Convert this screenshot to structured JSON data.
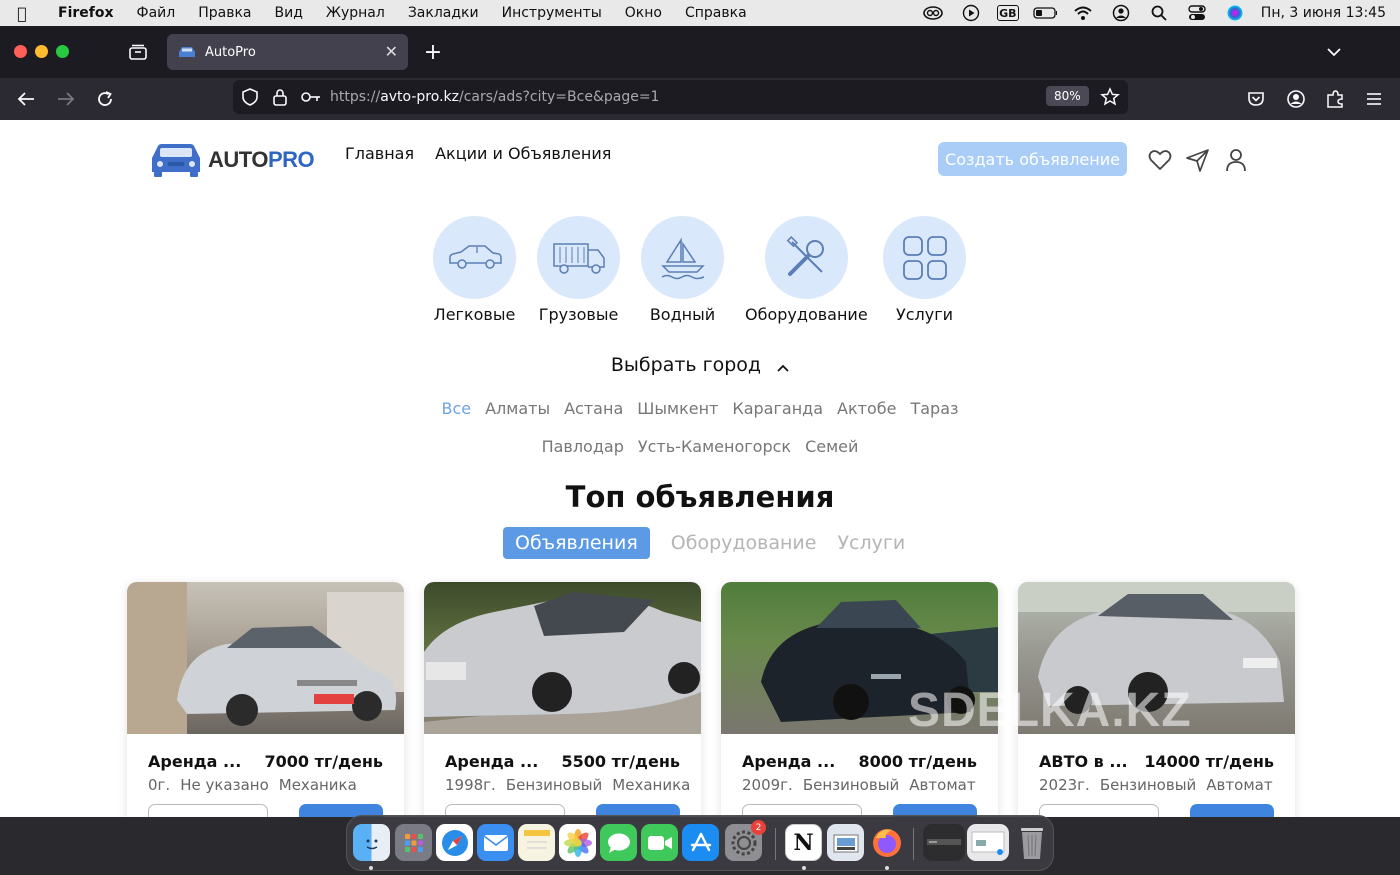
{
  "menubar": {
    "app_name": "Firefox",
    "items": [
      "Файл",
      "Правка",
      "Вид",
      "Журнал",
      "Закладки",
      "Инструменты",
      "Окно",
      "Справка"
    ],
    "clock": "Пн, 3 июня  13:45",
    "keyboard_layout": "GB"
  },
  "browser": {
    "tab_title": "AutoPro",
    "url_prefix": "https://",
    "url_domain": "avto-pro.kz",
    "url_path": "/cars/ads?city=Все&page=1",
    "zoom": "80%"
  },
  "site": {
    "logo_auto": "AUTO",
    "logo_pro": "PRO",
    "nav": [
      "Главная",
      "Акции и Объявления"
    ],
    "create_button": "Создать объявление",
    "categories": [
      {
        "label": "Легковые",
        "icon": "car-icon"
      },
      {
        "label": "Грузовые",
        "icon": "truck-icon"
      },
      {
        "label": "Водный",
        "icon": "boat-icon"
      },
      {
        "label": "Оборудование",
        "icon": "tools-icon"
      },
      {
        "label": "Услуги",
        "icon": "grid-icon"
      }
    ],
    "city_title": "Выбрать город",
    "cities_row1": [
      "Все",
      "Алматы",
      "Астана",
      "Шымкент",
      "Караганда",
      "Актобе",
      "Тараз"
    ],
    "cities_row2": [
      "Павлодар",
      "Усть-Каменогорск",
      "Семей"
    ],
    "active_city": "Все",
    "top_title": "Топ объявления",
    "tabs": [
      "Объявления",
      "Оборудование",
      "Услуги"
    ],
    "active_tab": "Объявления",
    "cards": [
      {
        "title": "Аренда ...",
        "price": "7000 тг/день",
        "year": "0г.",
        "fuel": "Не указано",
        "transmission": "Механика"
      },
      {
        "title": "Аренда ...",
        "price": "5500 тг/день",
        "year": "1998г.",
        "fuel": "Бензиновый",
        "transmission": "Механика"
      },
      {
        "title": "Аренда ...",
        "price": "8000 тг/день",
        "year": "2009г.",
        "fuel": "Бензиновый",
        "transmission": "Автомат"
      },
      {
        "title": "АВТО в ...",
        "price": "14000 тг/день",
        "year": "2023г.",
        "fuel": "Бензиновый",
        "transmission": "Автомат"
      }
    ],
    "watermark": "SDELKA.KZ"
  },
  "dock": {
    "apps": [
      "Finder",
      "Launchpad",
      "Safari",
      "Mail",
      "Notes",
      "Photos",
      "Messages",
      "FaceTime",
      "App Store",
      "System Settings",
      "Notion",
      "Preview",
      "Firefox",
      "Screenshot",
      "Trash"
    ],
    "settings_badge": "2"
  },
  "colors": {
    "accent": "#5c9ae6",
    "create_button": "#a9cdf7",
    "category_circle": "#d9e8fb",
    "logo_pro": "#2f66c4"
  }
}
